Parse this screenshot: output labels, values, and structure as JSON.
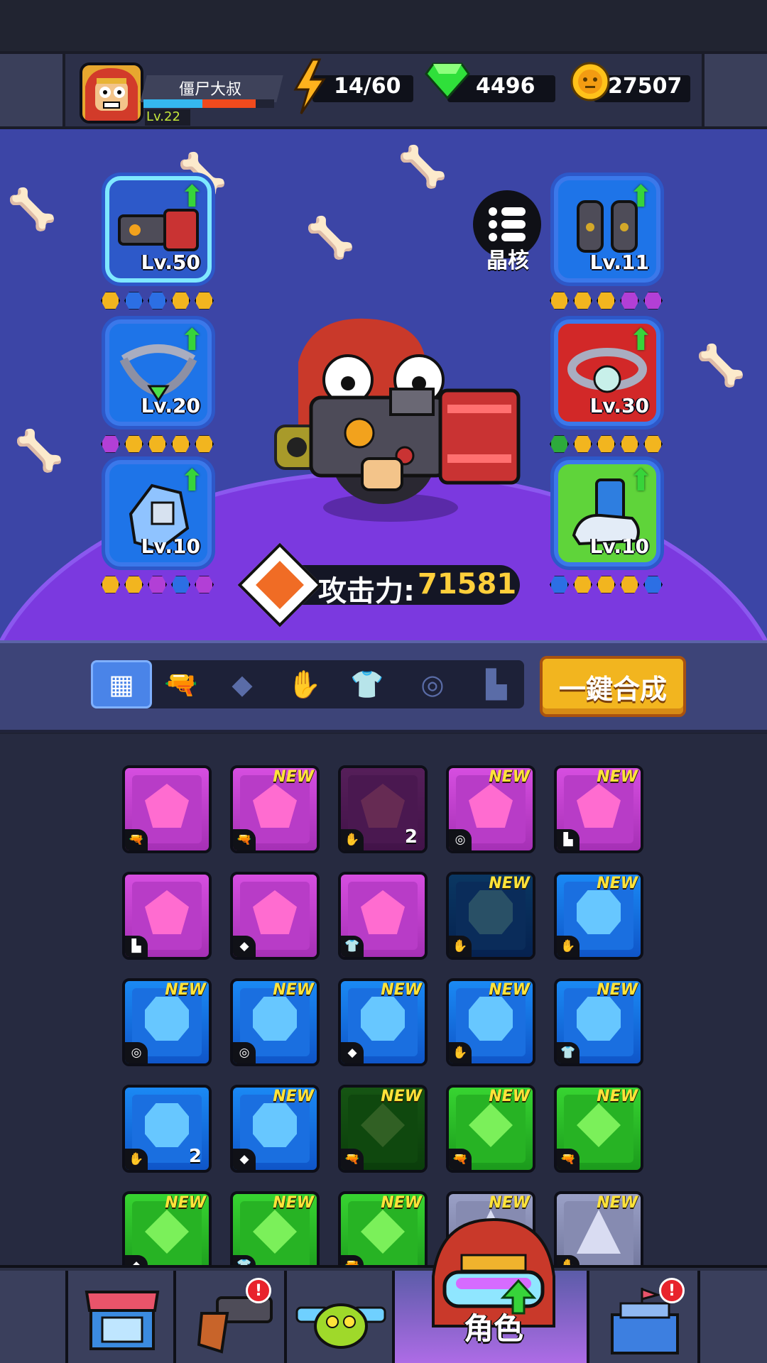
{
  "player": {
    "name": "僵尸大叔",
    "level": "Lv.22",
    "xp_progress": 0.86
  },
  "resources": {
    "energy": "14/60",
    "gems": "4496",
    "coins": "27507"
  },
  "equipment_left": [
    {
      "level": "Lv.50",
      "frame": "#7fe8ff",
      "bg": "#2d59c9",
      "upgrade": "⬆",
      "gems": [
        "#f2b51f",
        "#2c6fe4",
        "#2c6fe4",
        "#f2b51f",
        "#f2b51f"
      ]
    },
    {
      "level": "Lv.20",
      "frame": "#3b78ea",
      "bg": "#1e74e8",
      "upgrade": "⬆",
      "gems": [
        "#b23fd6",
        "#f2b51f",
        "#f2b51f",
        "#f2b51f",
        "#f2b51f"
      ]
    },
    {
      "level": "Lv.10",
      "frame": "#3b78ea",
      "bg": "#1e74e8",
      "upgrade": "⬆",
      "gems": [
        "#f2b51f",
        "#f2b51f",
        "#b23fd6",
        "#2c6fe4",
        "#b23fd6"
      ]
    }
  ],
  "equipment_right": [
    {
      "level": "Lv.11",
      "frame": "#3b78ea",
      "bg": "#1e74e8",
      "upgrade": "⬆",
      "gems": [
        "#f2b51f",
        "#f2b51f",
        "#f2b51f",
        "#b23fd6",
        "#b23fd6"
      ]
    },
    {
      "level": "Lv.30",
      "frame": "#3b78ea",
      "bg": "#d22828",
      "upgrade": "⬆",
      "gems": [
        "#2daa3b",
        "#f2b51f",
        "#f2b51f",
        "#f2b51f",
        "#f2b51f"
      ]
    },
    {
      "level": "Lv.10",
      "frame": "#3b78ea",
      "bg": "#5fd43a",
      "upgrade": "⬆",
      "gems": [
        "#2c6fe4",
        "#f2b51f",
        "#f2b51f",
        "#f2b51f",
        "#2c6fe4"
      ]
    }
  ],
  "core_button": {
    "label": "晶核",
    "icon": "list-icon"
  },
  "attack": {
    "label": "攻击力:",
    "value": "71581",
    "icon": "fist-icon"
  },
  "filter_tabs": [
    {
      "id": "all",
      "icon": "grid-icon",
      "glyph": "▦"
    },
    {
      "id": "weapon",
      "icon": "gun-icon",
      "glyph": "🔫"
    },
    {
      "id": "necklace",
      "icon": "necklace-icon",
      "glyph": "◆"
    },
    {
      "id": "glove",
      "icon": "glove-icon",
      "glyph": "✋"
    },
    {
      "id": "armor",
      "icon": "shirt-icon",
      "glyph": "👕"
    },
    {
      "id": "belt",
      "icon": "belt-icon",
      "glyph": "◎"
    },
    {
      "id": "boots",
      "icon": "boot-icon",
      "glyph": "▙"
    }
  ],
  "merge_button": "一鍵合成",
  "inventory": [
    {
      "rarity": "purple",
      "new": "",
      "type": "🔫",
      "count": "",
      "dim": false
    },
    {
      "rarity": "purple",
      "new": "NEW",
      "type": "🔫",
      "count": "",
      "dim": false
    },
    {
      "rarity": "purple",
      "new": "",
      "type": "✋",
      "count": "2",
      "dim": true
    },
    {
      "rarity": "purple",
      "new": "NEW",
      "type": "◎",
      "count": "",
      "dim": false
    },
    {
      "rarity": "purple",
      "new": "NEW",
      "type": "▙",
      "count": "",
      "dim": false
    },
    {
      "rarity": "purple",
      "new": "",
      "type": "▙",
      "count": "",
      "dim": false
    },
    {
      "rarity": "purple",
      "new": "",
      "type": "◆",
      "count": "",
      "dim": false
    },
    {
      "rarity": "purple",
      "new": "",
      "type": "👕",
      "count": "",
      "dim": false
    },
    {
      "rarity": "blue",
      "new": "NEW",
      "type": "✋",
      "count": "",
      "dim": true
    },
    {
      "rarity": "blue",
      "new": "NEW",
      "type": "✋",
      "count": "",
      "dim": false
    },
    {
      "rarity": "blue",
      "new": "NEW",
      "type": "◎",
      "count": "",
      "dim": false
    },
    {
      "rarity": "blue",
      "new": "NEW",
      "type": "◎",
      "count": "",
      "dim": false
    },
    {
      "rarity": "blue",
      "new": "NEW",
      "type": "◆",
      "count": "",
      "dim": false
    },
    {
      "rarity": "blue",
      "new": "NEW",
      "type": "✋",
      "count": "",
      "dim": false
    },
    {
      "rarity": "blue",
      "new": "NEW",
      "type": "👕",
      "count": "",
      "dim": false
    },
    {
      "rarity": "blue",
      "new": "",
      "type": "✋",
      "count": "2",
      "dim": false
    },
    {
      "rarity": "blue",
      "new": "NEW",
      "type": "◆",
      "count": "",
      "dim": false
    },
    {
      "rarity": "green",
      "new": "NEW",
      "type": "🔫",
      "count": "",
      "dim": true
    },
    {
      "rarity": "green",
      "new": "NEW",
      "type": "🔫",
      "count": "",
      "dim": false
    },
    {
      "rarity": "green",
      "new": "NEW",
      "type": "🔫",
      "count": "",
      "dim": false
    },
    {
      "rarity": "green",
      "new": "NEW",
      "type": "◆",
      "count": "",
      "dim": false
    },
    {
      "rarity": "green",
      "new": "NEW",
      "type": "👕",
      "count": "",
      "dim": false
    },
    {
      "rarity": "green",
      "new": "NEW",
      "type": "🔫",
      "count": "",
      "dim": false
    },
    {
      "rarity": "gray",
      "new": "NEW",
      "type": "",
      "count": "",
      "dim": false
    },
    {
      "rarity": "gray",
      "new": "NEW",
      "type": "✋",
      "count": "",
      "dim": false
    }
  ],
  "bottom_nav": [
    {
      "id": "shop",
      "icon": "shop-icon",
      "alert": false
    },
    {
      "id": "weapons",
      "icon": "pistol-icon",
      "alert": true,
      "alert_text": "!"
    },
    {
      "id": "pets",
      "icon": "creature-icon",
      "alert": false
    },
    {
      "id": "role",
      "icon": "hero-icon",
      "alert": false,
      "label": "角色",
      "active": true
    },
    {
      "id": "base",
      "icon": "fortress-icon",
      "alert": true,
      "alert_text": "!"
    }
  ]
}
